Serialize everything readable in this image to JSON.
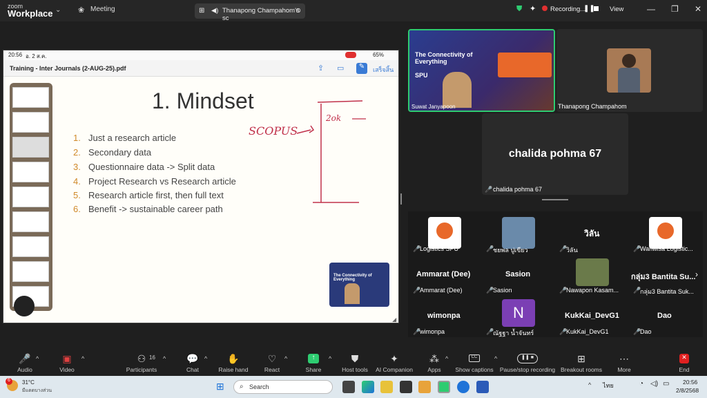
{
  "titlebar": {
    "logo_top": "zoom",
    "logo_bottom": "Workplace",
    "meeting_tab": "Meeting",
    "share_tab": "Thanapong Champahom's sc",
    "recording": "Recording...",
    "view": "View"
  },
  "tablet": {
    "time": "20:56",
    "date": "อ. 2 ส.ค.",
    "battery": "65%",
    "filename": "Training - Inter Journals (2-AUG-25).pdf",
    "done": "เสร็จสิ้น"
  },
  "slide": {
    "title": "1. Mindset",
    "items": [
      {
        "n": "1.",
        "t": "Just a research article"
      },
      {
        "n": "2.",
        "t": "Secondary data"
      },
      {
        "n": "3.",
        "t": "Questionnaire data -> Split data"
      },
      {
        "n": "4.",
        "t": "Project Research vs Research article"
      },
      {
        "n": "5.",
        "t": "Research article first, then full text"
      },
      {
        "n": "6.",
        "t": "Benefit -> sustainable career path"
      }
    ],
    "annotation_scopus": "SCOPUS",
    "annotation_note": "2ok",
    "thumb_title": "The Connectivity of Everything"
  },
  "participants": {
    "speaker": {
      "name": "Suwat Janyapoon",
      "banner": "The Connectivity of Everything",
      "brand": "SPU"
    },
    "thanapong": "Thanapong Champahom",
    "chalida": {
      "big": "chalida pohma 67",
      "label": "chalida pohma 67"
    },
    "grid": [
      {
        "big": "",
        "label": "Logistics SPU"
      },
      {
        "big": "",
        "label": "ชยพล ปูเขียว"
      },
      {
        "big": "วิลัน",
        "label": "วิลัน"
      },
      {
        "big": "",
        "label": "Wanwisa Logistic..."
      },
      {
        "big": "Ammarat (Dee)",
        "label": "Ammarat (Dee)"
      },
      {
        "big": "Sasion",
        "label": "Sasion"
      },
      {
        "big": "",
        "label": "Nawapon Kasam..."
      },
      {
        "big": "กลุ่ม3 Bantita Su...",
        "label": "กลุ่ม3 Bantita Suk..."
      },
      {
        "big": "wimonpa",
        "label": "wimonpa"
      },
      {
        "big": "N",
        "label": "ณัฐฐา น้ำจันทร์"
      },
      {
        "big": "KukKai_DevG1",
        "label": "KukKai_DevG1"
      },
      {
        "big": "Dao",
        "label": "Dao"
      }
    ]
  },
  "toolbar": {
    "audio": "Audio",
    "video": "Video",
    "participants": "Participants",
    "participant_count": "16",
    "chat": "Chat",
    "raise": "Raise hand",
    "react": "React",
    "share": "Share",
    "host": "Host tools",
    "ai": "AI Companion",
    "apps": "Apps",
    "captions": "Show captions",
    "pause": "Pause/stop recording",
    "breakout": "Breakout rooms",
    "more": "More",
    "end": "End"
  },
  "taskbar": {
    "temp": "31°C",
    "weather": "มีแดดบางส่วน",
    "search": "Search",
    "lang": "ไทย",
    "time": "20:56",
    "date": "2/8/2568",
    "badge": "6"
  },
  "colors": {
    "accent_green": "#2ecc71",
    "end_red": "#e02020",
    "onenote": "#7b3fb4"
  }
}
